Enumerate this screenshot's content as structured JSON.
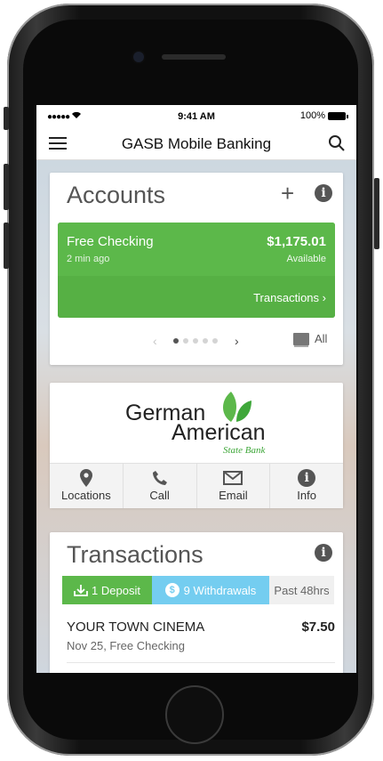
{
  "status_bar": {
    "signal": "●●●●● ",
    "time": "9:41 AM",
    "battery": "100%"
  },
  "nav": {
    "title": "GASB Mobile Banking"
  },
  "accounts": {
    "title": "Accounts",
    "add_label": "+",
    "account": {
      "name": "Free Checking",
      "updated": "2 min ago",
      "balance": "$1,175.01",
      "balance_label": "Available",
      "transactions_link": "Transactions"
    },
    "pager": {
      "prev": "‹",
      "next": "›",
      "current_page": 1,
      "total_pages": 5
    },
    "all_label": "All"
  },
  "bank": {
    "logo_line1": "German",
    "logo_line2": "American",
    "logo_sub": "State Bank",
    "actions": [
      {
        "label": "Locations",
        "icon": "location-pin-icon"
      },
      {
        "label": "Call",
        "icon": "phone-icon"
      },
      {
        "label": "Email",
        "icon": "envelope-icon"
      },
      {
        "label": "Info",
        "icon": "info-icon"
      }
    ]
  },
  "transactions": {
    "title": "Transactions",
    "filters": {
      "deposits": "1 Deposit",
      "withdrawals": "9 Withdrawals",
      "period": "Past 48hrs"
    },
    "items": [
      {
        "merchant": "YOUR TOWN CINEMA",
        "amount": "$7.50",
        "meta": "Nov 25, Free Checking"
      }
    ]
  },
  "colors": {
    "green": "#5cb84a",
    "blue": "#74cdf0",
    "text": "#555555"
  }
}
